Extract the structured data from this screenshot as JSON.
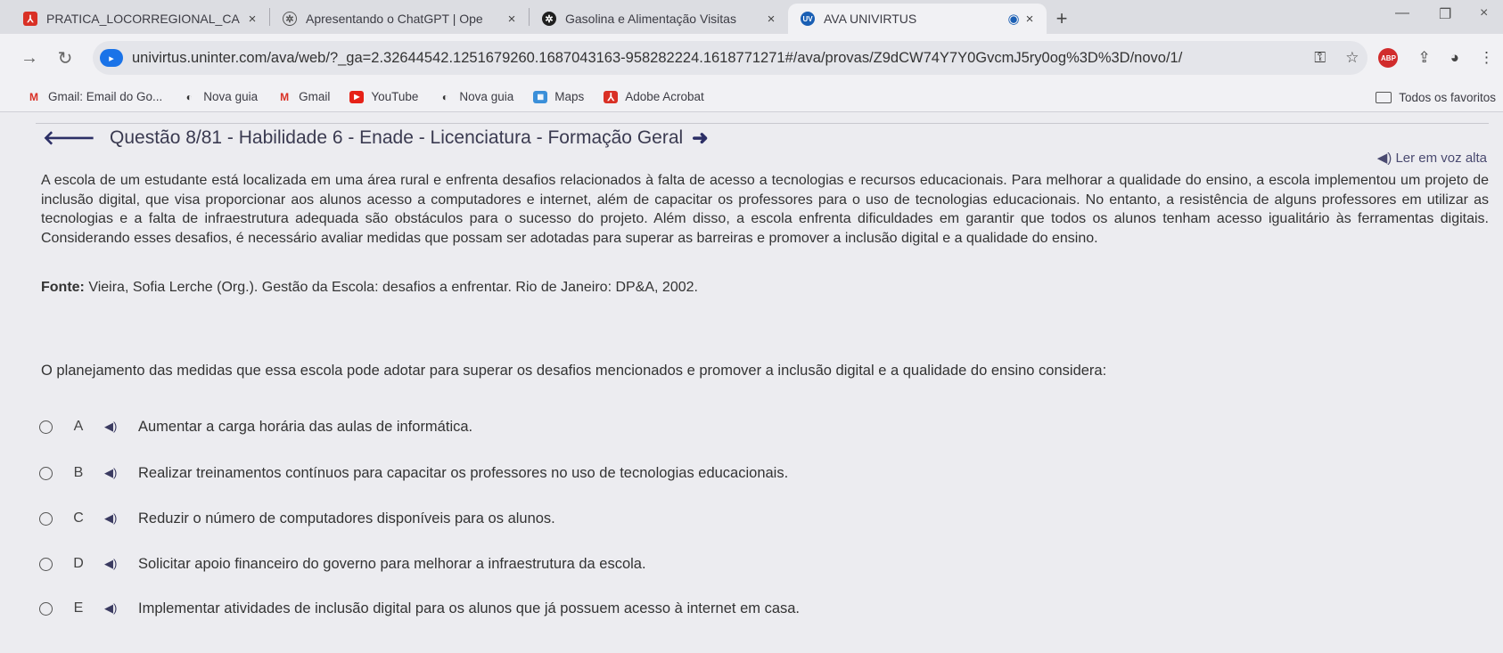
{
  "browser": {
    "tabs": [
      {
        "title": "PRATICA_LOCORREGIONAL_CA",
        "icon": "pdf-icon",
        "color": "#d93025"
      },
      {
        "title": "Apresentando o ChatGPT | Ope",
        "icon": "openai-icon",
        "color": "#555555"
      },
      {
        "title": "Gasolina e Alimentação Visitas",
        "icon": "chatgpt-icon",
        "color": "#1f1f1f"
      },
      {
        "title": "AVA UNIVIRTUS",
        "icon": "univirtus-icon",
        "color": "#1a5fb4"
      }
    ],
    "active_tab_close": "×",
    "close_glyph": "×",
    "new_tab": "+",
    "url": "univirtus.uninter.com/ava/web/?_ga=2.32644542.1251679260.1687043163-958282224.1618771271#/ava/provas/Z9dCW74Y7Y0GvcmJ5ry0og%3D%3D/novo/1/",
    "bookmarks": [
      {
        "label": "Gmail: Email do Go...",
        "icon": "gmail-icon"
      },
      {
        "label": "Nova guia",
        "icon": "globe-icon"
      },
      {
        "label": "Gmail",
        "icon": "gmail-icon"
      },
      {
        "label": "YouTube",
        "icon": "youtube-icon"
      },
      {
        "label": "Nova guia",
        "icon": "globe-icon"
      },
      {
        "label": "Maps",
        "icon": "maps-icon"
      },
      {
        "label": "Adobe Acrobat",
        "icon": "acrobat-icon"
      }
    ],
    "all_bookmarks": "Todos os favoritos"
  },
  "page": {
    "question_title": "Questão 8/81 - Habilidade 6 - Enade - Licenciatura - Formação Geral",
    "listen_label": "Ler em voz alta",
    "stem": "A escola de um estudante está localizada em uma área rural e enfrenta desafios relacionados à falta de acesso a tecnologias e recursos educacionais. Para melhorar a qualidade do ensino, a escola implementou um projeto de inclusão digital, que visa proporcionar aos alunos acesso a computadores e internet, além de capacitar os professores para o uso de tecnologias educacionais. No entanto, a resistência de alguns professores em utilizar as tecnologias e a falta de infraestrutura adequada são obstáculos para o sucesso do projeto. Além disso, a escola enfrenta dificuldades em garantir que todos os alunos tenham acesso igualitário às ferramentas digitais. Considerando esses desafios, é necessário avaliar medidas que possam ser adotadas para superar as barreiras e promover a inclusão digital e a qualidade do ensino.",
    "source_label": "Fonte:",
    "source_text": "Vieira, Sofia Lerche (Org.). Gestão da Escola: desafios a enfrentar. Rio de Janeiro: DP&A, 2002.",
    "question": "O planejamento das medidas que essa escola pode adotar para superar os desafios mencionados e promover a inclusão digital e a qualidade do ensino considera:",
    "options": [
      {
        "letter": "A",
        "text": "Aumentar a carga horária das aulas de informática."
      },
      {
        "letter": "B",
        "text": "Realizar treinamentos contínuos para capacitar os professores no uso de tecnologias educacionais."
      },
      {
        "letter": "C",
        "text": "Reduzir o número de computadores disponíveis para os alunos."
      },
      {
        "letter": "D",
        "text": "Solicitar apoio financeiro do governo para melhorar a infraestrutura da escola."
      },
      {
        "letter": "E",
        "text": "Implementar atividades de inclusão digital para os alunos que já possuem acesso à internet em casa."
      }
    ]
  }
}
